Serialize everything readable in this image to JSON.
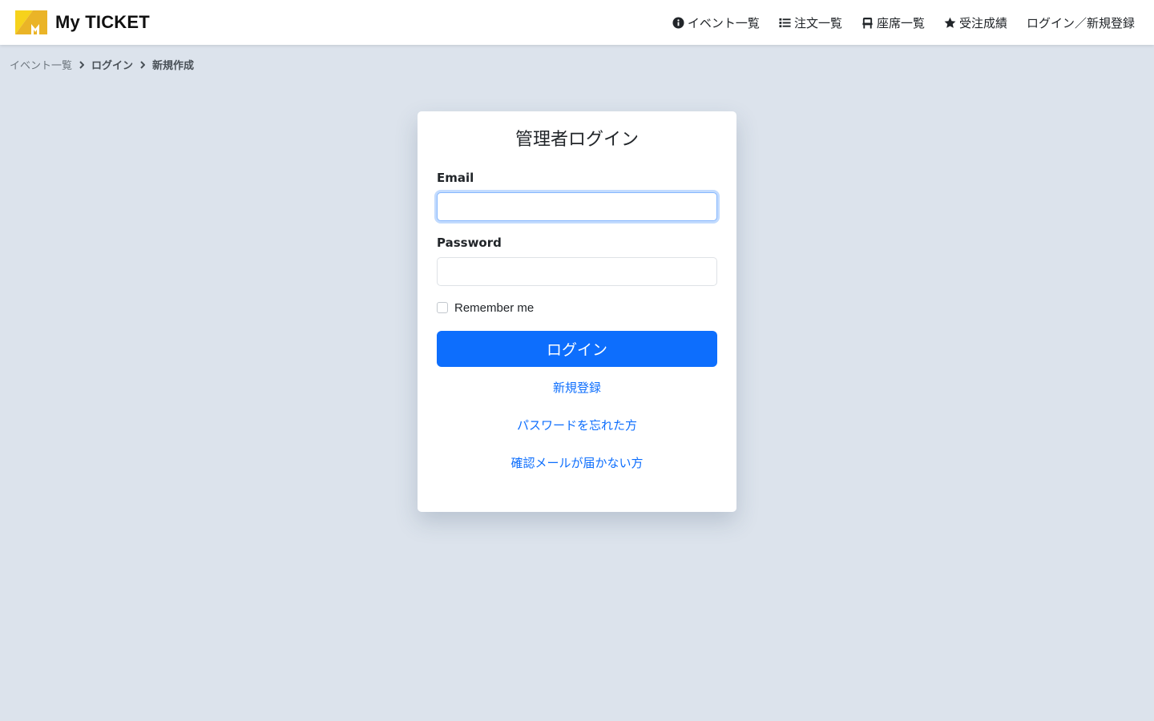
{
  "colors": {
    "background": "#dce3ec",
    "primary": "#0d6efd",
    "logo_yellow": "#f5c518",
    "logo_orange": "#e8a317"
  },
  "header": {
    "brand_name": "My TICKET",
    "nav": [
      {
        "label": "イベント一覧",
        "icon": "info-circle-icon"
      },
      {
        "label": "注文一覧",
        "icon": "list-icon"
      },
      {
        "label": "座席一覧",
        "icon": "chair-icon"
      },
      {
        "label": "受注成績",
        "icon": "star-icon"
      },
      {
        "label": "ログイン／新規登録",
        "icon": ""
      }
    ]
  },
  "breadcrumb": [
    {
      "label": "イベント一覧"
    },
    {
      "label": "ログイン"
    },
    {
      "label": "新規作成"
    }
  ],
  "login_form": {
    "title": "管理者ログイン",
    "email_label": "Email",
    "email_value": "",
    "password_label": "Password",
    "password_value": "",
    "remember_label": "Remember me",
    "remember_checked": false,
    "submit_label": "ログイン",
    "links": [
      {
        "label": "新規登録"
      },
      {
        "label": "パスワードを忘れた方"
      },
      {
        "label": "確認メールが届かない方"
      }
    ]
  }
}
